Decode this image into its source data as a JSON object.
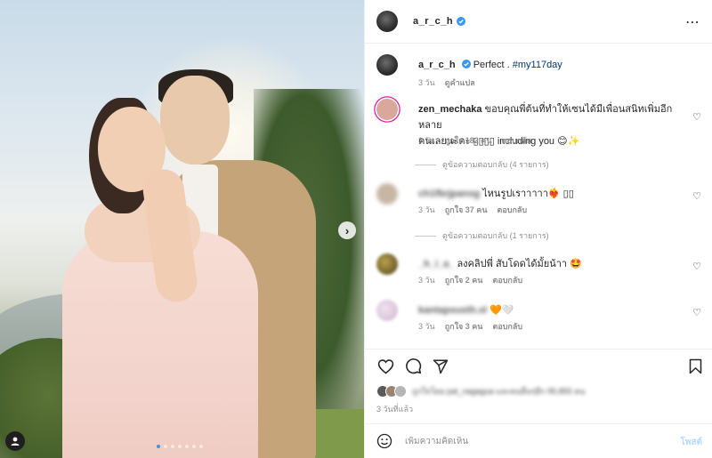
{
  "post": {
    "author": "a_r_c_h",
    "caption_text": "Perfect .",
    "caption_hashtag": "#my117day",
    "caption_time": "3 วัน",
    "caption_translate": "ดูคำแปล"
  },
  "comments": [
    {
      "username": "zen_mechaka",
      "text_line1": "ขอบคุณพี่ต้นที่ทำให้เซนได้มีเพื่อนสนิทเพิ่มอีกหลาย",
      "text_line2": "คนเลยนะคะ ▯▯▯▯ including you 😊✨",
      "time": "3 วัน",
      "likes": "ถูกใจ 182 คน",
      "reply": "ตอบกลับ",
      "view_replies": "ดูข้อความตอบกลับ (4 รายการ)"
    },
    {
      "username": "ch1fbrjpansg",
      "text": "ไหนรูปเราาาาา❤️‍🔥 ▯▯",
      "time": "3 วัน",
      "likes": "ถูกใจ 37 คน",
      "reply": "ตอบกลับ",
      "view_replies": "ดูข้อความตอบกลับ (1 รายการ)"
    },
    {
      "username": "_h_i_a_",
      "text": "ลงคลิปพี่ สับโดดได้มั้ยน้าา 🤩",
      "time": "3 วัน",
      "likes": "ถูกใจ 2 คน",
      "reply": "ตอบกลับ"
    },
    {
      "username": "kantapsusth.sl",
      "text": "🧡🤍",
      "time": "3 วัน",
      "likes": "ถูกใจ 3 คน",
      "reply": "ตอบกลับ"
    }
  ],
  "likes_summary": "ถูกใจโดย pat_nagagua และคนอื่นๆอีก 95,855 คน",
  "posted_time": "3 วันที่แล้ว",
  "comment_box": {
    "placeholder": "เพิ่มความคิดเห็น",
    "post_label": "โพสต์"
  },
  "carousel": {
    "slide_count": 7,
    "active_index": 1
  },
  "colors": {
    "link": "#00376b",
    "verified": "#3897f0",
    "post_button": "#b3dbff",
    "muted": "#8e8e8e"
  },
  "icons": [
    "more-options-icon",
    "verified-icon",
    "heart-icon",
    "comment-icon",
    "share-icon",
    "bookmark-icon",
    "emoji-icon",
    "next-arrow-icon",
    "user-icon"
  ]
}
